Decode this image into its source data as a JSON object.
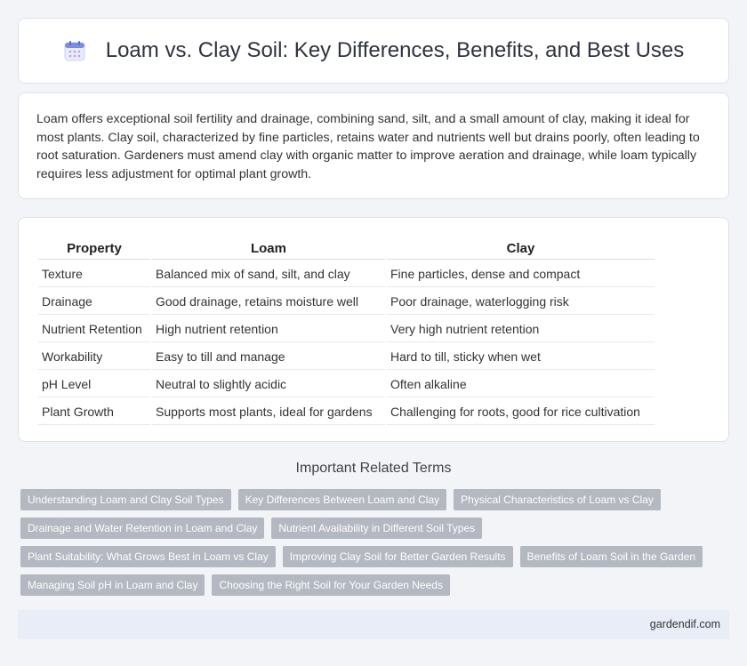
{
  "header": {
    "title": "Loam vs. Clay Soil: Key Differences, Benefits, and Best Uses",
    "icon": "calendar-icon",
    "icon_color": "#6b7fd7"
  },
  "intro": {
    "text": "Loam offers exceptional soil fertility and drainage, combining sand, silt, and a small amount of clay, making it ideal for most plants. Clay soil, characterized by fine particles, retains water and nutrients well but drains poorly, often leading to root saturation. Gardeners must amend clay with organic matter to improve aeration and drainage, while loam typically requires less adjustment for optimal plant growth."
  },
  "table": {
    "headers": [
      "Property",
      "Loam",
      "Clay"
    ],
    "rows": [
      [
        "Texture",
        "Balanced mix of sand, silt, and clay",
        "Fine particles, dense and compact"
      ],
      [
        "Drainage",
        "Good drainage, retains moisture well",
        "Poor drainage, waterlogging risk"
      ],
      [
        "Nutrient Retention",
        "High nutrient retention",
        "Very high nutrient retention"
      ],
      [
        "Workability",
        "Easy to till and manage",
        "Hard to till, sticky when wet"
      ],
      [
        "pH Level",
        "Neutral to slightly acidic",
        "Often alkaline"
      ],
      [
        "Plant Growth",
        "Supports most plants, ideal for gardens",
        "Challenging for roots, good for rice cultivation"
      ]
    ]
  },
  "related": {
    "title": "Important Related Terms",
    "tags": [
      [
        "Understanding Loam and Clay Soil Types",
        "Key Differences Between Loam and Clay",
        "Physical Characteristics of Loam vs Clay"
      ],
      [
        "Drainage and Water Retention in Loam and Clay",
        "Nutrient Availability in Different Soil Types"
      ],
      [
        "Plant Suitability: What Grows Best in Loam vs Clay",
        "Improving Clay Soil for Better Garden Results",
        "Benefits of Loam Soil in the Garden"
      ],
      [
        "Managing Soil pH in Loam and Clay",
        "Choosing the Right Soil for Your Garden Needs"
      ]
    ]
  },
  "footer": {
    "site": "gardendif.com"
  }
}
